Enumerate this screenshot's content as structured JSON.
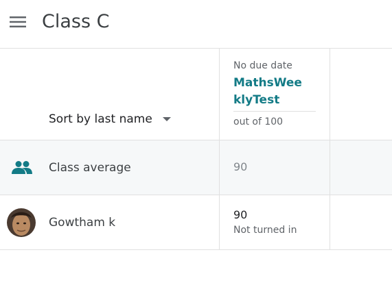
{
  "header": {
    "title": "Class C",
    "menu_icon": "hamburger-menu-icon"
  },
  "table": {
    "sort_label": "Sort by last name",
    "sort_icon": "dropdown-arrow-icon",
    "assignment": {
      "due": "No due date",
      "title": "MathsWeeklyTest",
      "points": "out of 100"
    },
    "class_average": {
      "icon": "people-icon",
      "label": "Class average",
      "value": "90"
    },
    "students": [
      {
        "name": "Gowtham k",
        "grade": "90",
        "status": "Not turned in"
      }
    ]
  },
  "colors": {
    "accent": "#137b86",
    "row_highlight": "#f6f8f9",
    "divider": "#e0e0e0"
  }
}
